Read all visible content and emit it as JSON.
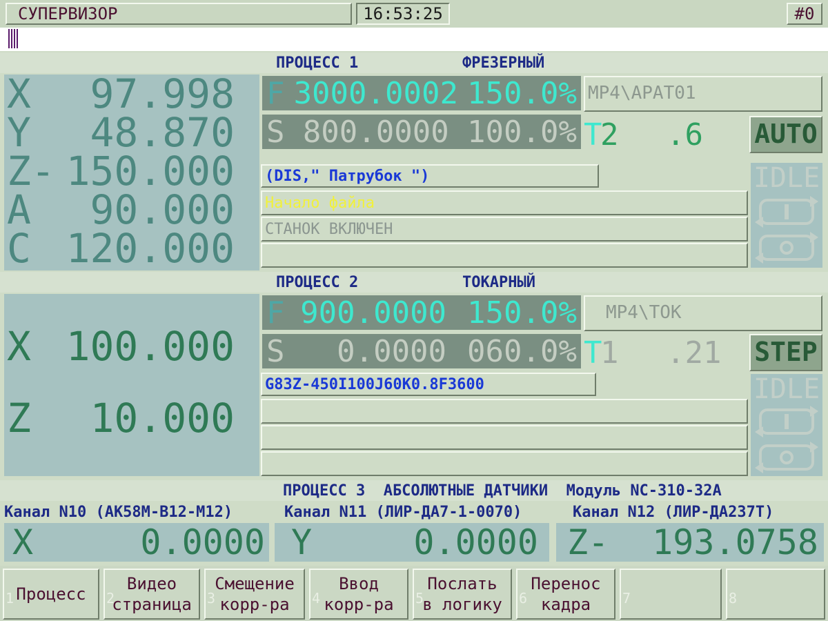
{
  "topbar": {
    "title": "СУПЕРВИЗОР",
    "time": "16:53:25",
    "channel": "#0"
  },
  "process1": {
    "header_name": "ПРОЦЕСС 1",
    "header_type": "ФРЕЗЕРНЫЙ",
    "axes": [
      {
        "name": "X",
        "value": "97.998"
      },
      {
        "name": "Y",
        "value": "48.870"
      },
      {
        "name": "Z-",
        "value": "150.000"
      },
      {
        "name": "A",
        "value": "90.000"
      },
      {
        "name": "C",
        "value": "120.000"
      }
    ],
    "feed": {
      "letter": "F",
      "value": "3000.0002",
      "percent": "150.0%"
    },
    "spindle": {
      "letter": "S",
      "value": "800.0000",
      "percent": "100.0%"
    },
    "program": "МР4\\АРАТ01",
    "tool": {
      "letter": "T",
      "number": "2",
      "corr": ".6"
    },
    "mode": "AUTO",
    "state": "IDLE",
    "messages": [
      "(DIS,\" Патрубок \")",
      "Начало файла",
      "СТАНОК ВКЛЮЧЕН",
      ""
    ]
  },
  "process2": {
    "header_name": "ПРОЦЕСС 2",
    "header_type": "ТОКАРНЫЙ",
    "axes": [
      {
        "name": "X",
        "value": "100.000"
      },
      {
        "name": "Z",
        "value": "10.000"
      }
    ],
    "feed": {
      "letter": "F",
      "value": "900.0000",
      "percent": "150.0%"
    },
    "spindle": {
      "letter": "S",
      "value": "0.0000",
      "percent": "060.0%"
    },
    "program": "МР4\\ТОК",
    "tool": {
      "letter": "T",
      "number": "1",
      "corr": ".21"
    },
    "mode": "STEP",
    "state": "IDLE",
    "messages": [
      "G83Z-450I100J60K0.8F3600",
      "",
      "",
      ""
    ]
  },
  "process3": {
    "header": "ПРОЦЕСС 3  АБСОЛЮТНЫЕ ДАТЧИКИ  Модуль NC-310-32A",
    "channels": [
      {
        "label": "Канал N10 (AK58M-B12-M12)",
        "axis": "X",
        "value": "0.0000"
      },
      {
        "label": "Канал N11 (ЛИР-ДА7-1-0070)",
        "axis": "Y",
        "value": "0.0000"
      },
      {
        "label": "Канал N12 (ЛИР-ДА237Т)",
        "axis": "Z-",
        "value": "193.0758"
      }
    ]
  },
  "fkeys": [
    {
      "num": "1",
      "line1": "Процесс",
      "line2": ""
    },
    {
      "num": "2",
      "line1": "Видео",
      "line2": "страница"
    },
    {
      "num": "3",
      "line1": "Смещение",
      "line2": "корр-ра"
    },
    {
      "num": "4",
      "line1": "Ввод",
      "line2": "корр-ра"
    },
    {
      "num": "5",
      "line1": "Послать",
      "line2": "в логику"
    },
    {
      "num": "6",
      "line1": "Перенос",
      "line2": "кадра"
    },
    {
      "num": "7",
      "line1": "",
      "line2": ""
    },
    {
      "num": "8",
      "line1": "",
      "line2": ""
    }
  ],
  "colors": {
    "background": "#cfdcc7",
    "axis_panel": "#a6c2c1",
    "header_text": "#1d2a86",
    "feed_bar": "#7a8f82",
    "feed_text": "#3ee8cf",
    "message_yellow": "#f1f13a",
    "message_blue": "#1a39d6"
  }
}
